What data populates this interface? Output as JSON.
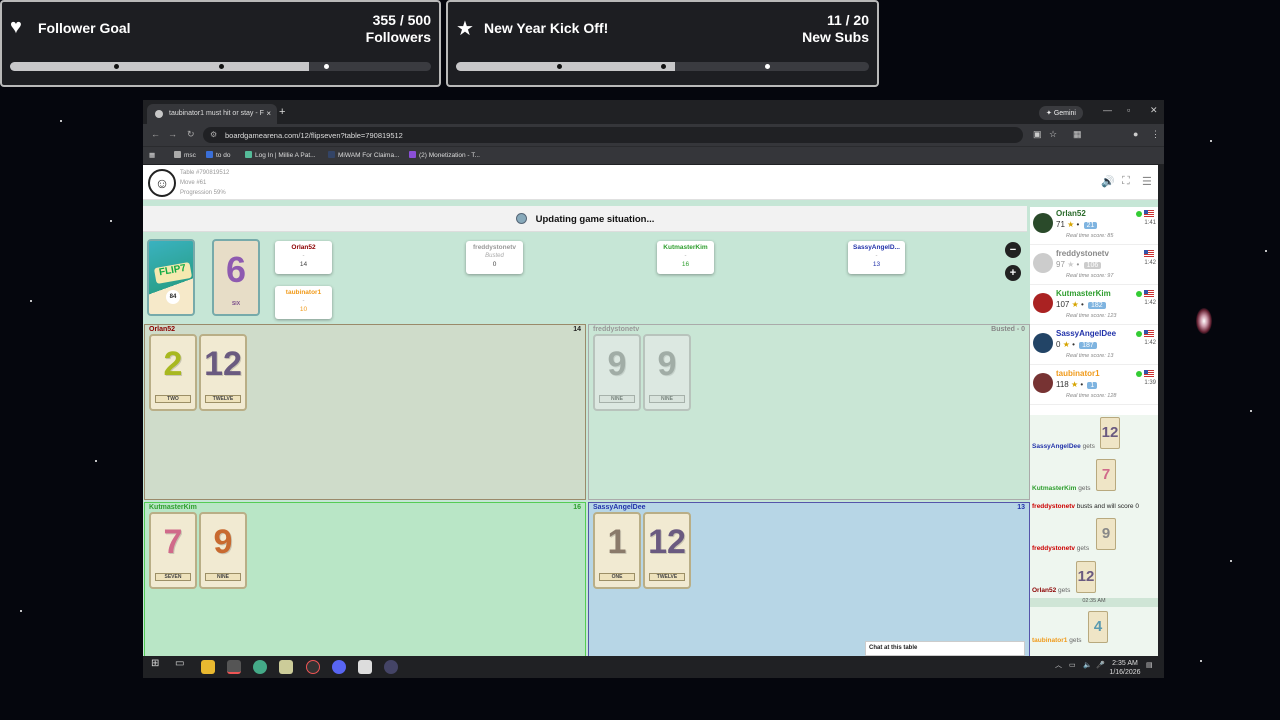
{
  "stream_overlay": {
    "follower_goal": {
      "title": "Follower Goal",
      "count": "355 / 500",
      "unit": "Followers",
      "progress": 0.71
    },
    "sub_goal": {
      "title": "New Year Kick Off!",
      "count": "11 / 20",
      "unit": "New Subs",
      "progress": 0.55
    }
  },
  "browser": {
    "tab_title": "taubinator1 must hit or stay - F",
    "gemini_label": "Gemini",
    "url": "boardgamearena.com/12/flipseven?table=790819512",
    "bookmarks": [
      "msc",
      "to do",
      "Log In | Millie A Pat...",
      "MiWAM For Claima...",
      "(2) Monetization - T..."
    ]
  },
  "game": {
    "table_info": {
      "table": "Table #790819512",
      "move": "Move #61",
      "progression": "Progression 59%"
    },
    "status_text": "Updating game situation...",
    "deck": {
      "logo": "FLIP7",
      "count": "84"
    },
    "discard": {
      "number": "6",
      "word": "SIX"
    },
    "top_players": [
      {
        "name": "Orlan52",
        "status": "-",
        "score": "14",
        "color": "#8b0000"
      },
      {
        "name": "freddystonetv",
        "status": "Busted",
        "score": "0",
        "color": "#999999"
      },
      {
        "name": "KutmasterKim",
        "status": "-",
        "score": "16",
        "color": "#2e9e2e"
      },
      {
        "name": "SassyAngelD...",
        "status": "-",
        "score": "13",
        "color": "#2233aa"
      },
      {
        "name": "taubinator1",
        "status": "-",
        "score": "10",
        "color": "#f09a1a"
      }
    ],
    "zoom_out": "−",
    "zoom_in": "+",
    "areas": [
      {
        "name": "Orlan52",
        "score": "14",
        "cards": [
          {
            "n": "2",
            "w": "TWO",
            "color": "#a8b820"
          },
          {
            "n": "12",
            "w": "TWELVE",
            "color": "#6a5a80"
          }
        ]
      },
      {
        "name": "freddystonetv",
        "score": "Busted - 0",
        "cards": [
          {
            "n": "9",
            "w": "NINE",
            "color": "#888888"
          },
          {
            "n": "9",
            "w": "NINE",
            "color": "#888888"
          }
        ]
      },
      {
        "name": "KutmasterKim",
        "score": "16",
        "cards": [
          {
            "n": "7",
            "w": "SEVEN",
            "color": "#d06a8a"
          },
          {
            "n": "9",
            "w": "NINE",
            "color": "#c86a30"
          }
        ]
      },
      {
        "name": "SassyAngelDee",
        "score": "13",
        "cards": [
          {
            "n": "1",
            "w": "ONE",
            "color": "#8a7a6a"
          },
          {
            "n": "12",
            "w": "TWELVE",
            "color": "#6a5a80"
          }
        ]
      }
    ],
    "sidebar_players": [
      {
        "name": "Orlan52",
        "score": "71",
        "elo": "21",
        "realtime": "Real time score: 85",
        "time": "1:41",
        "color": "#2a6a2a"
      },
      {
        "name": "freddystonetv",
        "score": "97",
        "elo": "106",
        "realtime": "Real time score: 97",
        "time": "1:42",
        "color": "#888888"
      },
      {
        "name": "KutmasterKim",
        "score": "107",
        "elo": "182",
        "realtime": "Real time score: 123",
        "time": "1:42",
        "color": "#2e9e2e"
      },
      {
        "name": "SassyAngelDee",
        "score": "0",
        "elo": "187",
        "realtime": "Real time score: 13",
        "time": "1:42",
        "color": "#2233aa"
      },
      {
        "name": "taubinator1",
        "score": "118",
        "elo": "1",
        "realtime": "Real time score: 128",
        "time": "1:39",
        "color": "#f09a1a"
      }
    ],
    "log": [
      {
        "who": "SassyAngelDee",
        "text": "gets",
        "card": "12"
      },
      {
        "who": "KutmasterKim",
        "text": "gets",
        "card": "7"
      },
      {
        "who": "freddystonetv",
        "text": "busts and will score 0",
        "card": ""
      },
      {
        "who": "freddystonetv",
        "text": "gets",
        "card": "9"
      },
      {
        "who": "Orlan52",
        "text": "gets",
        "card": "12"
      },
      {
        "who": "taubinator1",
        "text": "gets",
        "card": "4"
      }
    ],
    "log_time": "02:35 AM",
    "chat_label": "Chat at this table"
  },
  "taskbar": {
    "time": "2:35 AM",
    "date": "1/16/2026"
  }
}
